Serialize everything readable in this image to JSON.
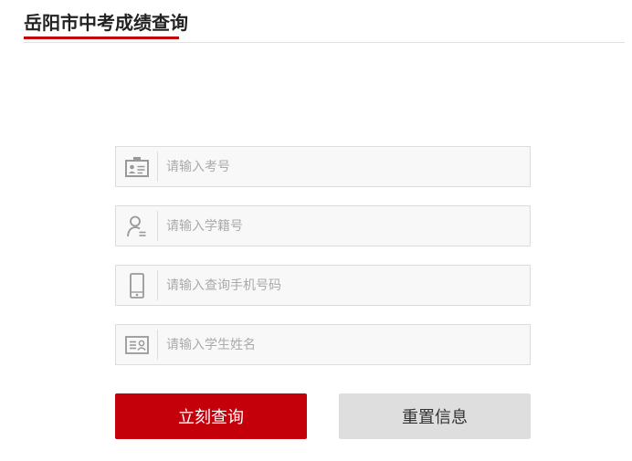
{
  "header": {
    "title": "岳阳市中考成绩查询"
  },
  "form": {
    "fields": [
      {
        "icon": "id-badge-icon",
        "placeholder": "请输入考号"
      },
      {
        "icon": "user-icon",
        "placeholder": "请输入学籍号"
      },
      {
        "icon": "mobile-phone-icon",
        "placeholder": "请输入查询手机号码"
      },
      {
        "icon": "id-card-icon",
        "placeholder": "请输入学生姓名"
      }
    ]
  },
  "actions": {
    "submit_label": "立刻查询",
    "reset_label": "重置信息"
  },
  "colors": {
    "accent": "#c4000b",
    "secondary_button": "#dedede",
    "field_background": "#f8f8f8",
    "field_border": "#dcdcdc",
    "icon": "#999999"
  }
}
